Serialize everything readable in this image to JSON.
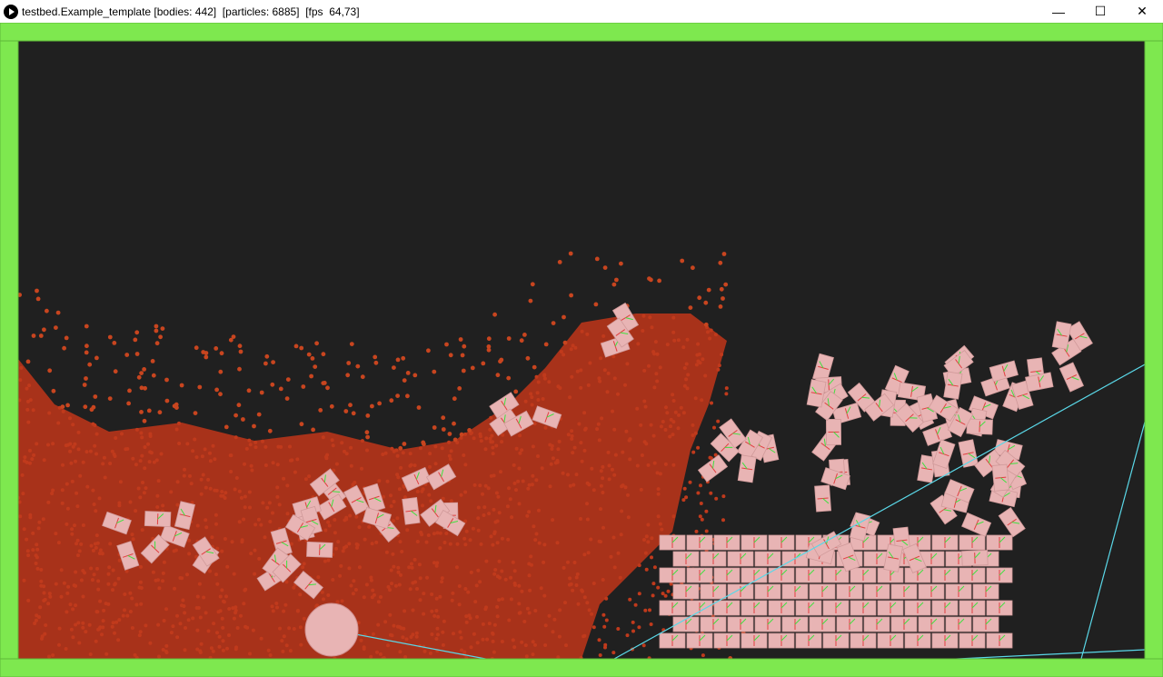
{
  "window": {
    "title": "testbed.Example_template [bodies: 442]  [particles: 6885]  [fps  64,73]",
    "buttons": {
      "minimize": "—",
      "maximize": "☐",
      "close": "✕"
    }
  },
  "colors": {
    "background": "#202020",
    "walls": "#7ee84f",
    "particles": "#c03a1c",
    "bodies": "#e8b4b4",
    "joints": "#5ad8e8"
  },
  "icons": [
    "play-icon",
    "minimize-icon",
    "maximize-icon",
    "close-icon"
  ]
}
